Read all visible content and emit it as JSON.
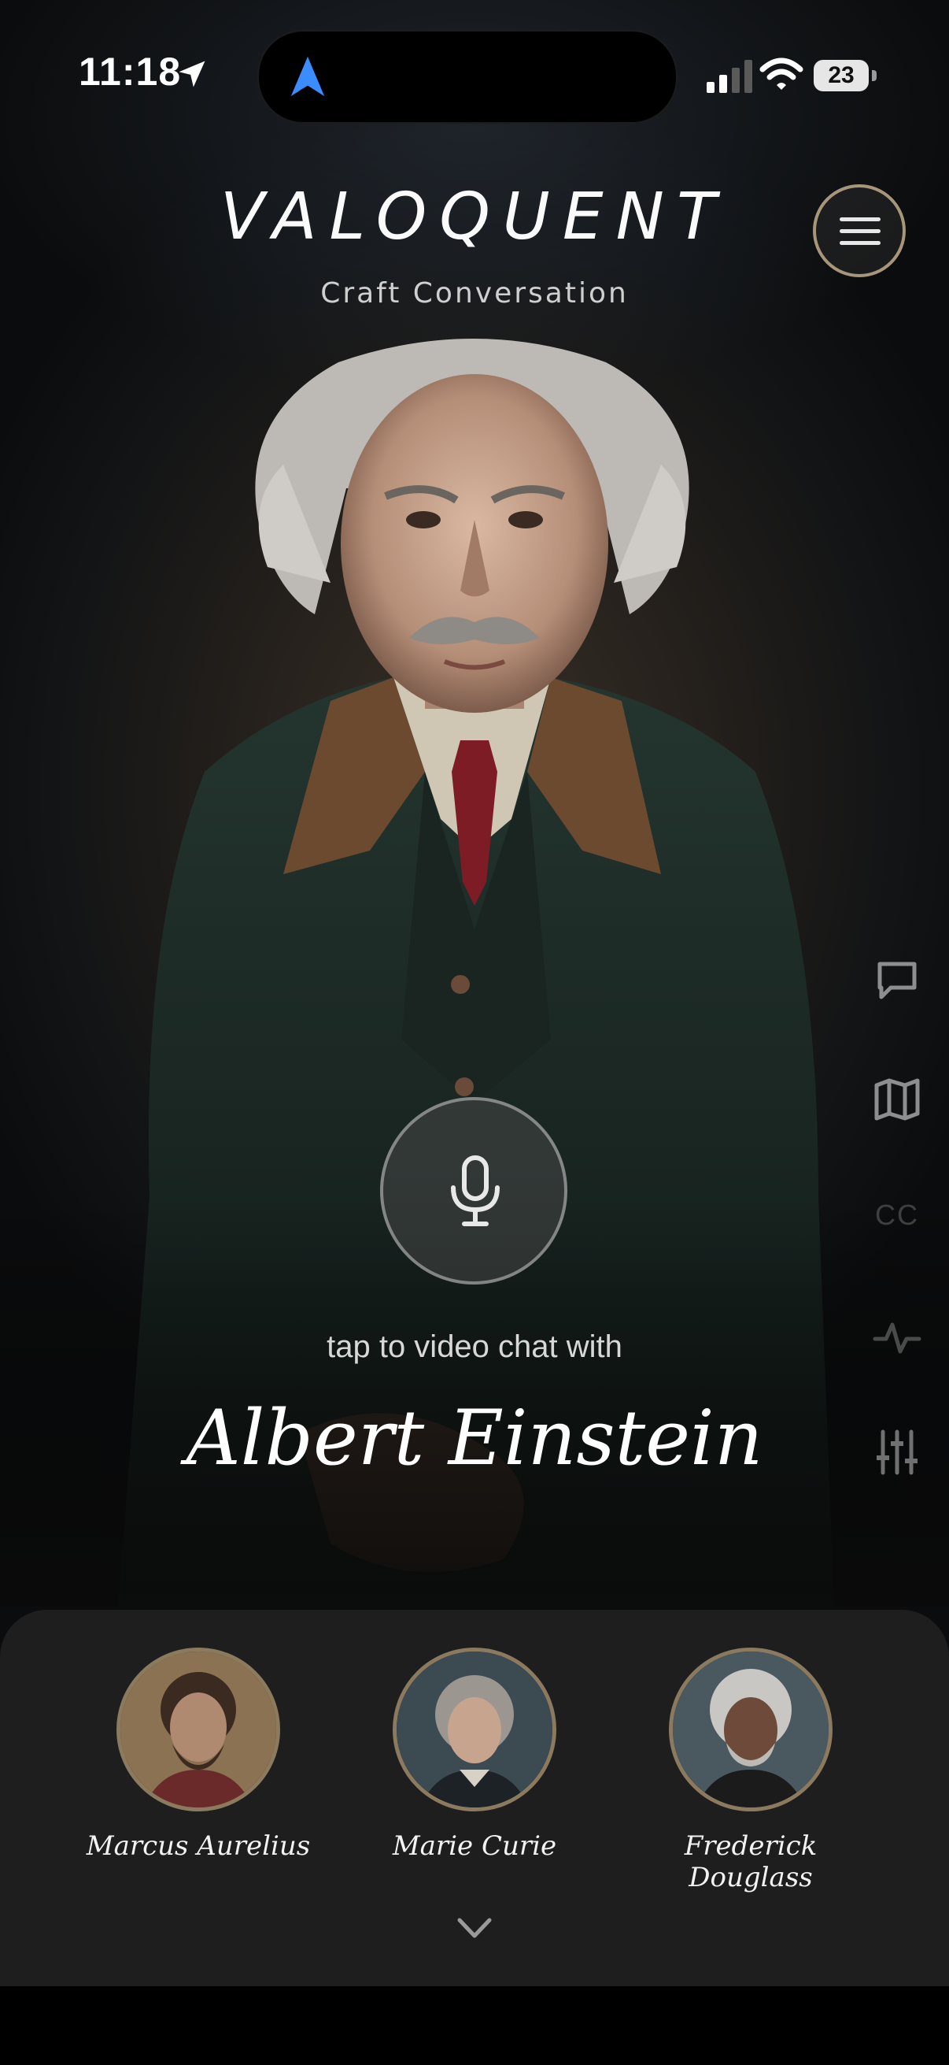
{
  "status_bar": {
    "time": "11:18",
    "battery": "23",
    "icons": [
      "location-arrow-icon",
      "navigation-icon",
      "signal-icon",
      "wifi-icon",
      "battery-icon"
    ]
  },
  "header": {
    "title": "VALOQUENT",
    "subtitle": "Craft Conversation",
    "menu_icon": "hamburger-menu-icon"
  },
  "side_toolbar": {
    "items": [
      {
        "icon": "chat-bubble-icon"
      },
      {
        "icon": "map-icon"
      },
      {
        "icon": "closed-captions-icon",
        "label": "CC"
      },
      {
        "icon": "activity-pulse-icon"
      },
      {
        "icon": "sliders-icon"
      }
    ]
  },
  "main": {
    "mic_icon": "microphone-icon",
    "tap_label": "tap to video chat with",
    "persona_name": "Albert Einstein"
  },
  "persona_picker": {
    "personas": [
      {
        "name": "Marcus Aurelius"
      },
      {
        "name": "Marie Curie"
      },
      {
        "name": "Frederick Douglass"
      }
    ],
    "expand_icon": "chevron-down-icon"
  },
  "colors": {
    "accent_ring": "#a7967a",
    "sheet_background": "#1e1e1e",
    "nav_blue": "#3b8cff"
  }
}
